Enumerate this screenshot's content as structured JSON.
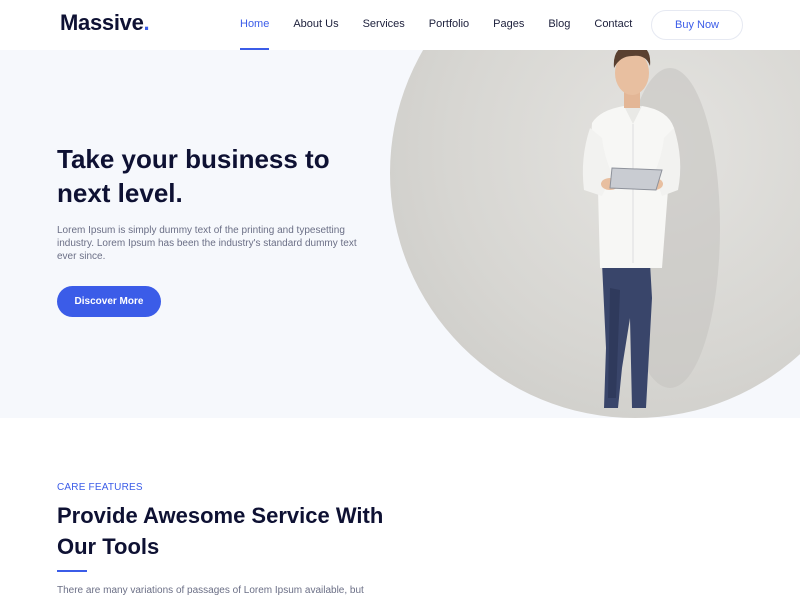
{
  "brand": {
    "name": "Massive",
    "dot": "."
  },
  "nav": {
    "items": [
      {
        "label": "Home"
      },
      {
        "label": "About Us"
      },
      {
        "label": "Services"
      },
      {
        "label": "Portfolio"
      },
      {
        "label": "Pages"
      },
      {
        "label": "Blog"
      },
      {
        "label": "Contact"
      }
    ],
    "active_index": 0,
    "cta_label": "Buy Now"
  },
  "hero": {
    "title": "Take your business to next level.",
    "text": "Lorem Ipsum is simply dummy text of the printing and typesetting industry. Lorem Ipsum has been the industry's standard dummy text ever since.",
    "button_label": "Discover More"
  },
  "features": {
    "tag": "CARE FEATURES",
    "title": "Provide Awesome Service With Our Tools",
    "text": "There are many variations of passages of Lorem Ipsum available, but"
  },
  "colors": {
    "accent": "#3b5ce8",
    "heading": "#0e1133",
    "body_text": "#6b6f86",
    "hero_bg": "#f6f8fc"
  }
}
